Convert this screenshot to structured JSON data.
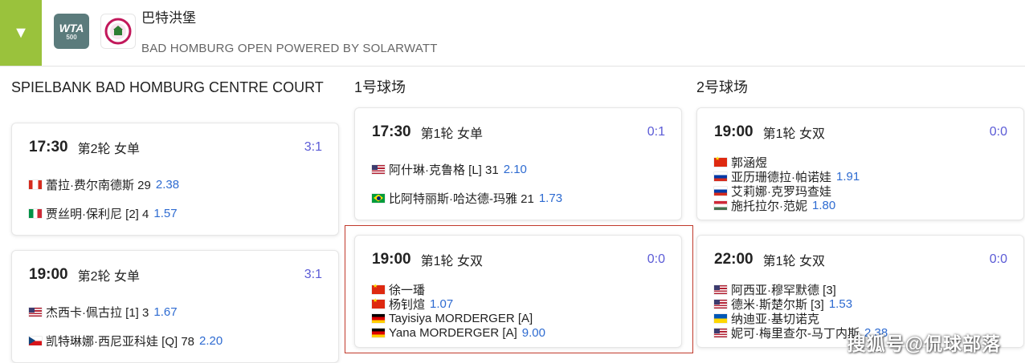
{
  "header": {
    "toggle_icon": "▼",
    "wta_logo_text": "WTA",
    "wta_logo_tier": "500",
    "title": "巴特洪堡",
    "subtitle": "BAD HOMBURG OPEN POWERED BY SOLARWATT"
  },
  "courts": [
    {
      "name": "SPIELBANK BAD HOMBURG CENTRE COURT",
      "matches": [
        {
          "time": "17:30",
          "round": "第2轮 女单",
          "score": "3:1",
          "p1": {
            "flag": "ca",
            "name": "蕾拉·费尔南德斯 29",
            "odd": "2.38"
          },
          "p2": {
            "flag": "it",
            "name": "贾丝明·保利尼 [2] 4",
            "odd": "1.57"
          }
        },
        {
          "time": "19:00",
          "round": "第2轮 女单",
          "score": "3:1",
          "p1": {
            "flag": "us",
            "name": "杰西卡·佩古拉 [1] 3",
            "odd": "1.67"
          },
          "p2": {
            "flag": "cz",
            "name": "凯特琳娜·西尼亚科娃 [Q] 78",
            "odd": "2.20"
          }
        }
      ]
    },
    {
      "name": "1号球场",
      "matches": [
        {
          "time": "17:30",
          "round": "第1轮 女单",
          "score": "0:1",
          "p1": {
            "flag": "us",
            "name": "阿什琳·克鲁格 [L] 31",
            "odd": "2.10"
          },
          "p2": {
            "flag": "br",
            "name": "比阿特丽斯·哈达德-玛雅 21",
            "odd": "1.73"
          }
        },
        {
          "time": "19:00",
          "round": "第1轮 女双",
          "score": "0:0",
          "t1": {
            "a_flag": "cn",
            "a_name": "徐一璠",
            "b_flag": "cn",
            "b_name": "杨钊煊",
            "odd": "1.07"
          },
          "t2": {
            "a_flag": "de",
            "a_name": "Tayisiya MORDERGER [A]",
            "b_flag": "de",
            "b_name": "Yana MORDERGER [A]",
            "odd": "9.00"
          }
        }
      ]
    },
    {
      "name": "2号球场",
      "matches": [
        {
          "time": "19:00",
          "round": "第1轮 女双",
          "score": "0:0",
          "t1": {
            "a_flag": "cn",
            "a_name": "郭涵煜",
            "b_flag": "ru",
            "b_name": "亚历珊德拉·帕诺娃",
            "odd": "1.91"
          },
          "t2": {
            "a_flag": "ru",
            "a_name": "艾莉娜·克罗玛查娃",
            "b_flag": "hu",
            "b_name": "施托拉尔·范妮",
            "odd": "1.80"
          }
        },
        {
          "time": "22:00",
          "round": "第1轮 女双",
          "score": "0:0",
          "t1": {
            "a_flag": "us",
            "a_name": "阿西亚·穆罕默德 [3]",
            "b_flag": "us",
            "b_name": "德米·斯楚尔斯 [3]",
            "odd": "1.53"
          },
          "t2": {
            "a_flag": "ua",
            "a_name": "纳迪亚·基切诺克",
            "b_flag": "us",
            "b_name": "妮可·梅里查尔-马丁内斯",
            "odd": "2.38"
          }
        }
      ]
    }
  ],
  "watermark": "搜狐号@侃球部落",
  "colors": {
    "toggle_bg": "#9ac23c",
    "score": "#5b5bd6",
    "odd": "#2e6bd1",
    "highlight_border": "#c0392b"
  }
}
